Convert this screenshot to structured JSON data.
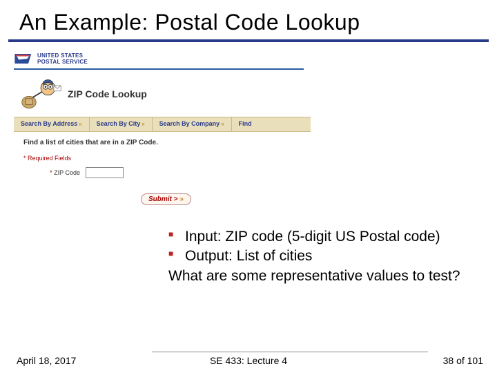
{
  "title": "An Example: Postal Code Lookup",
  "usps": {
    "line1": "UNITED STATES",
    "line2": "POSTAL SERVICE"
  },
  "lookup_title": "ZIP Code Lookup",
  "tabs": {
    "t0": "Search By Address",
    "t1": "Search By City",
    "t2": "Search By Company",
    "t3": "Find"
  },
  "form": {
    "instruction": "Find a list of cities that are in a ZIP Code.",
    "required": "* Required Fields",
    "zip_label": "ZIP Code",
    "submit": "Submit >"
  },
  "bullets": {
    "b0": "Input: ZIP code (5-digit US Postal code)",
    "b1": "Output: List of cities"
  },
  "followup": "What are some representative values to test?",
  "footer": {
    "date": "April 18, 2017",
    "center": "SE 433: Lecture 4",
    "page": "38 of 101"
  }
}
